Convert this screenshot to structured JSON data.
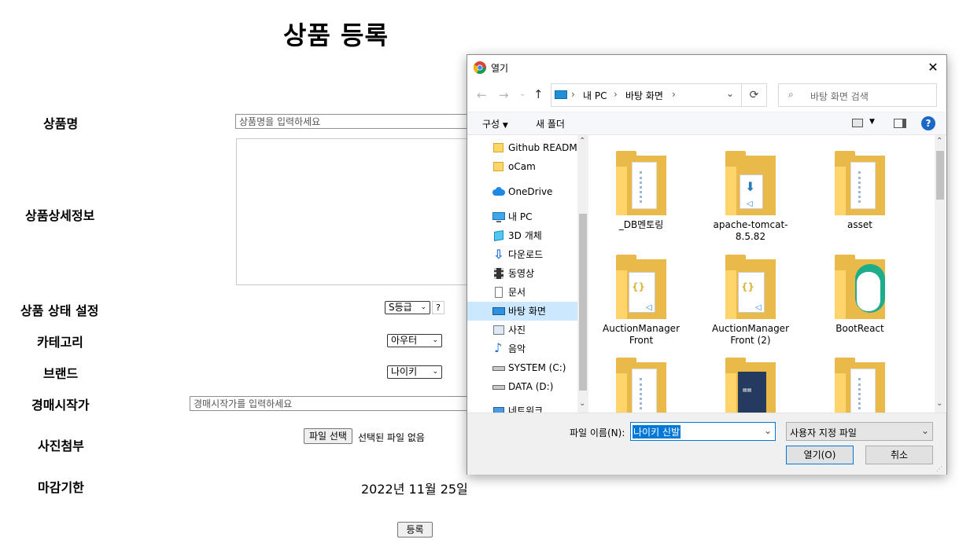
{
  "page": {
    "title": "상품 등록",
    "labels": {
      "name": "상품명",
      "detail": "상품상세정보",
      "condition": "상품 상태 설정",
      "category": "카테고리",
      "brand": "브랜드",
      "start_price": "경매시작가",
      "photo": "사진첨부",
      "deadline": "마감기한"
    },
    "name_placeholder": "상품명을 입력하세요",
    "start_price_placeholder": "경매시작가를 입력하세요",
    "condition_value": "S등급",
    "condition_help": "?",
    "category_value": "아우터",
    "brand_value": "나이키",
    "file_button": "파일 선택",
    "file_status": "선택된 파일 없음",
    "deadline_value": "2022년 11월 25일",
    "submit": "등록"
  },
  "dialog": {
    "title": "열기",
    "close": "✕",
    "breadcrumb": [
      "내 PC",
      "바탕 화면"
    ],
    "search_placeholder": "바탕 화면 검색",
    "organize": "구성",
    "new_folder": "새 폴더",
    "nav": [
      {
        "label": "Github README",
        "icon": "folder-icon"
      },
      {
        "label": "oCam",
        "icon": "folder-icon"
      },
      {
        "label": "OneDrive",
        "icon": "cloud-icon"
      },
      {
        "label": "내 PC",
        "icon": "pc-icon"
      },
      {
        "label": "3D 개체",
        "icon": "cube-icon"
      },
      {
        "label": "다운로드",
        "icon": "download-icon"
      },
      {
        "label": "동영상",
        "icon": "video-icon"
      },
      {
        "label": "문서",
        "icon": "document-icon"
      },
      {
        "label": "바탕 화면",
        "icon": "desktop-icon",
        "selected": true
      },
      {
        "label": "사진",
        "icon": "picture-icon"
      },
      {
        "label": "음악",
        "icon": "music-icon"
      },
      {
        "label": "SYSTEM (C:)",
        "icon": "drive-icon"
      },
      {
        "label": "DATA (D:)",
        "icon": "drive-icon"
      },
      {
        "label": "네트워크",
        "icon": "network-icon"
      }
    ],
    "files": [
      {
        "name": "_DB멘토링",
        "icon": "folder-doc-icon"
      },
      {
        "name": "apache-tomcat-8.5.82",
        "icon": "folder-vscode-icon"
      },
      {
        "name": "asset",
        "icon": "folder-doc-icon"
      },
      {
        "name": "AuctionManager Front",
        "icon": "folder-code-icon"
      },
      {
        "name": "AuctionManager Front (2)",
        "icon": "folder-code-icon"
      },
      {
        "name": "BootReact",
        "icon": "folder-app-icon"
      },
      {
        "name": "",
        "icon": "folder-doc-icon"
      },
      {
        "name": "",
        "icon": "folder-book-icon"
      },
      {
        "name": "",
        "icon": "folder-doc-icon"
      }
    ],
    "filename_label": "파일 이름(N):",
    "filename_value": "나이키 신발",
    "filetype_value": "사용자 지정 파일",
    "open_button": "열기(O)",
    "cancel_button": "취소"
  }
}
